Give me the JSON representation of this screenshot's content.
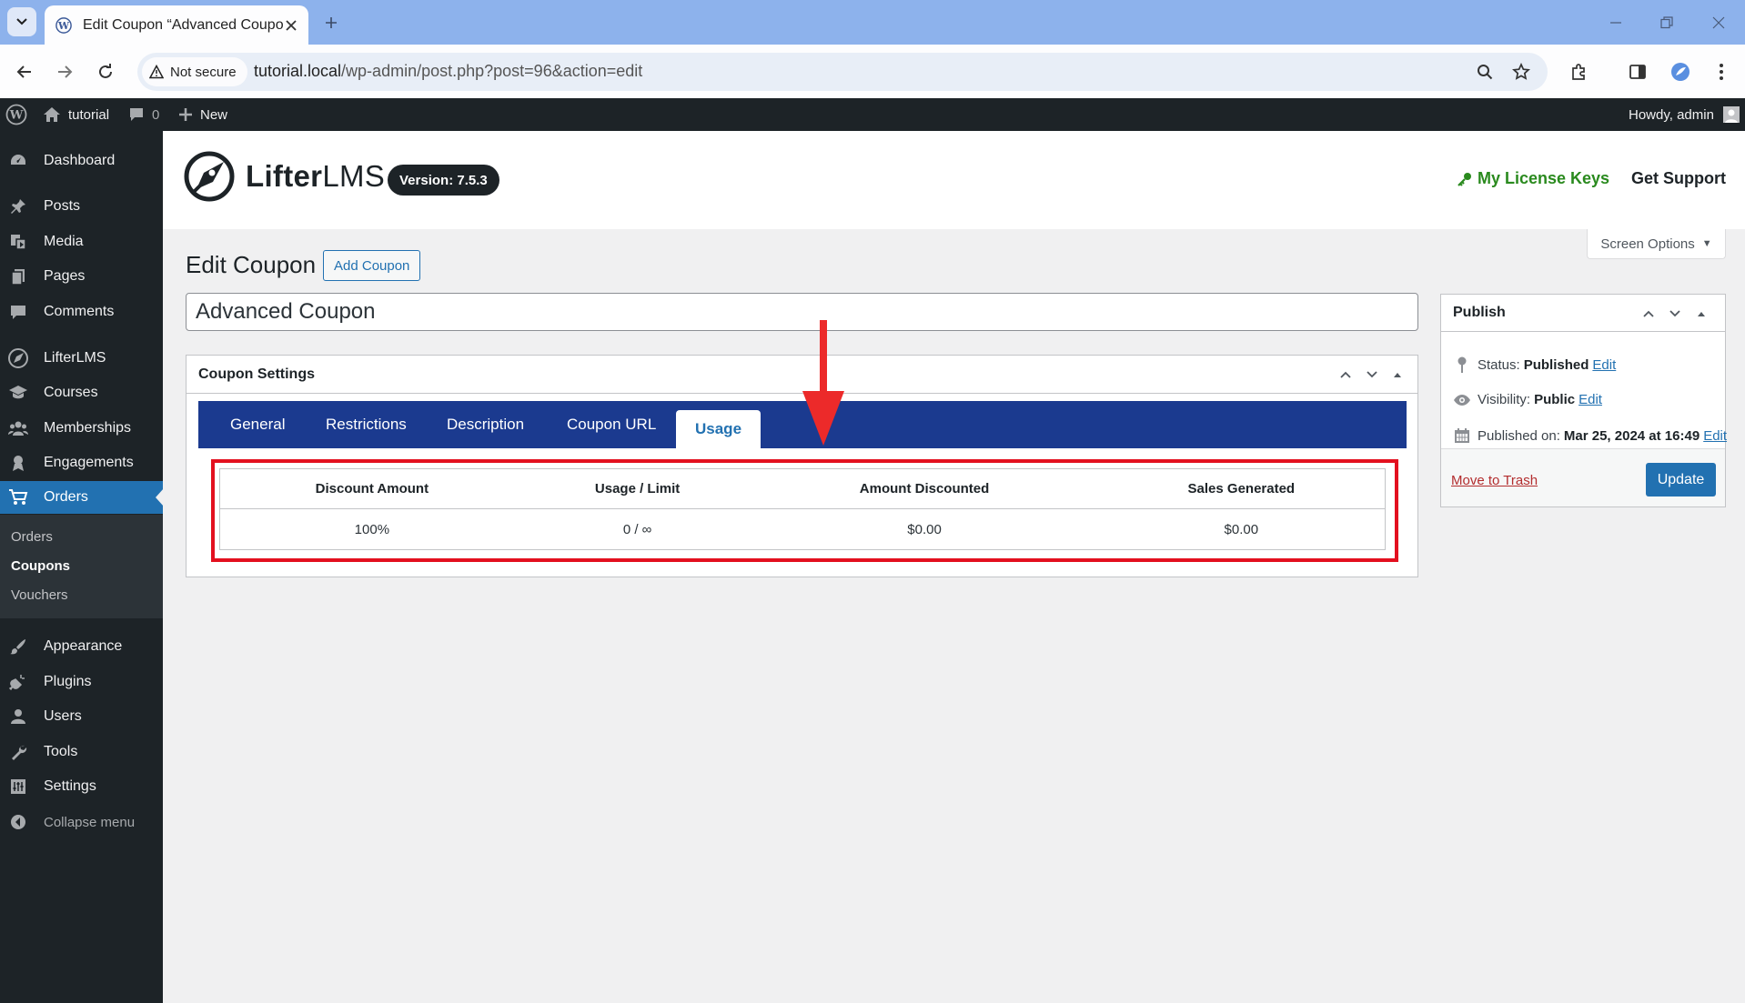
{
  "browser": {
    "tab_title": "Edit Coupon “Advanced Coupo",
    "security_label": "Not secure",
    "url_host": "tutorial.local",
    "url_path": "/wp-admin/post.php?post=96&action=edit"
  },
  "adminbar": {
    "site_name": "tutorial",
    "comments_count": "0",
    "new_label": "New",
    "howdy": "Howdy, admin"
  },
  "sidebar": {
    "dashboard": "Dashboard",
    "posts": "Posts",
    "media": "Media",
    "pages": "Pages",
    "comments": "Comments",
    "lifterlms": "LifterLMS",
    "courses": "Courses",
    "memberships": "Memberships",
    "engagements": "Engagements",
    "orders": "Orders",
    "sub_orders": "Orders",
    "sub_coupons": "Coupons",
    "sub_vouchers": "Vouchers",
    "appearance": "Appearance",
    "plugins": "Plugins",
    "users": "Users",
    "tools": "Tools",
    "settings": "Settings",
    "collapse": "Collapse menu"
  },
  "header": {
    "logo_part1": "Lifter",
    "logo_part2": "LMS",
    "version": "Version: 7.5.3",
    "license_keys": "My License Keys",
    "support": "Get Support",
    "screen_options": "Screen Options"
  },
  "main": {
    "page_title": "Edit Coupon",
    "add_button": "Add Coupon",
    "coupon_title": "Advanced Coupon",
    "settings_title": "Coupon Settings",
    "tabs": [
      "General",
      "Restrictions",
      "Description",
      "Coupon URL",
      "Usage"
    ],
    "usage_table": {
      "headers": [
        "Discount Amount",
        "Usage / Limit",
        "Amount Discounted",
        "Sales Generated"
      ],
      "row": [
        "100%",
        "0 / ∞",
        "$0.00",
        "$0.00"
      ]
    }
  },
  "publish": {
    "title": "Publish",
    "status_label": "Status:",
    "status_value": "Published",
    "visibility_label": "Visibility:",
    "visibility_value": "Public",
    "published_label": "Published on:",
    "published_value": "Mar 25, 2024 at 16:49",
    "edit_link": "Edit",
    "trash_link": "Move to Trash",
    "update_button": "Update"
  },
  "colors": {
    "wp_dark": "#1d2327",
    "wp_blue": "#2271b1",
    "tab_bar": "#1b3a8f",
    "highlight_red": "#e3101f",
    "license_green": "#2a8a1e"
  }
}
